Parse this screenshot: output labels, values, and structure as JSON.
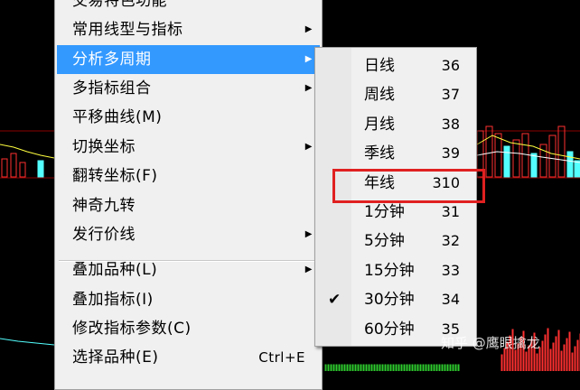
{
  "menu": {
    "items": [
      {
        "label": "交易特色功能",
        "has_submenu": false,
        "shortcut": ""
      },
      {
        "label": "常用线型与指标",
        "has_submenu": true,
        "shortcut": ""
      },
      {
        "label": "分析多周期",
        "has_submenu": true,
        "shortcut": "",
        "active": true
      },
      {
        "label": "多指标组合",
        "has_submenu": true,
        "shortcut": ""
      },
      {
        "label": "平移曲线(M)",
        "has_submenu": false,
        "shortcut": ""
      },
      {
        "label": "切换坐标",
        "has_submenu": true,
        "shortcut": ""
      },
      {
        "label": "翻转坐标(F)",
        "has_submenu": false,
        "shortcut": ""
      },
      {
        "label": "神奇九转",
        "has_submenu": false,
        "shortcut": ""
      },
      {
        "label": "发行价线",
        "has_submenu": true,
        "shortcut": ""
      },
      {
        "label": "叠加品种(L)",
        "has_submenu": true,
        "shortcut": ""
      },
      {
        "label": "叠加指标(I)",
        "has_submenu": false,
        "shortcut": ""
      },
      {
        "label": "修改指标参数(C)",
        "has_submenu": false,
        "shortcut": ""
      },
      {
        "label": "选择品种(E)",
        "has_submenu": false,
        "shortcut": "Ctrl+E"
      }
    ],
    "arrow_glyph": "▶"
  },
  "submenu": {
    "items": [
      {
        "label": "日线",
        "code": "36",
        "checked": false
      },
      {
        "label": "周线",
        "code": "37",
        "checked": false
      },
      {
        "label": "月线",
        "code": "38",
        "checked": false
      },
      {
        "label": "季线",
        "code": "39",
        "checked": false
      },
      {
        "label": "年线",
        "code": "310",
        "checked": false
      },
      {
        "label": "1分钟",
        "code": "31",
        "checked": false,
        "highlighted": true
      },
      {
        "label": "5分钟",
        "code": "32",
        "checked": false
      },
      {
        "label": "15分钟",
        "code": "33",
        "checked": false
      },
      {
        "label": "30分钟",
        "code": "34",
        "checked": true
      },
      {
        "label": "60分钟",
        "code": "35",
        "checked": false
      }
    ],
    "check_glyph": "✔"
  },
  "watermark": "知乎 @鹰眼擒龙",
  "colors": {
    "menu_bg": "#f0f0f0",
    "active_bg": "#3399ff",
    "highlight_border": "#e02020",
    "chart_bg": "#000000",
    "bar_red": "#ff3030",
    "bar_cyan": "#54ffff",
    "line_yellow": "#ffff40"
  }
}
